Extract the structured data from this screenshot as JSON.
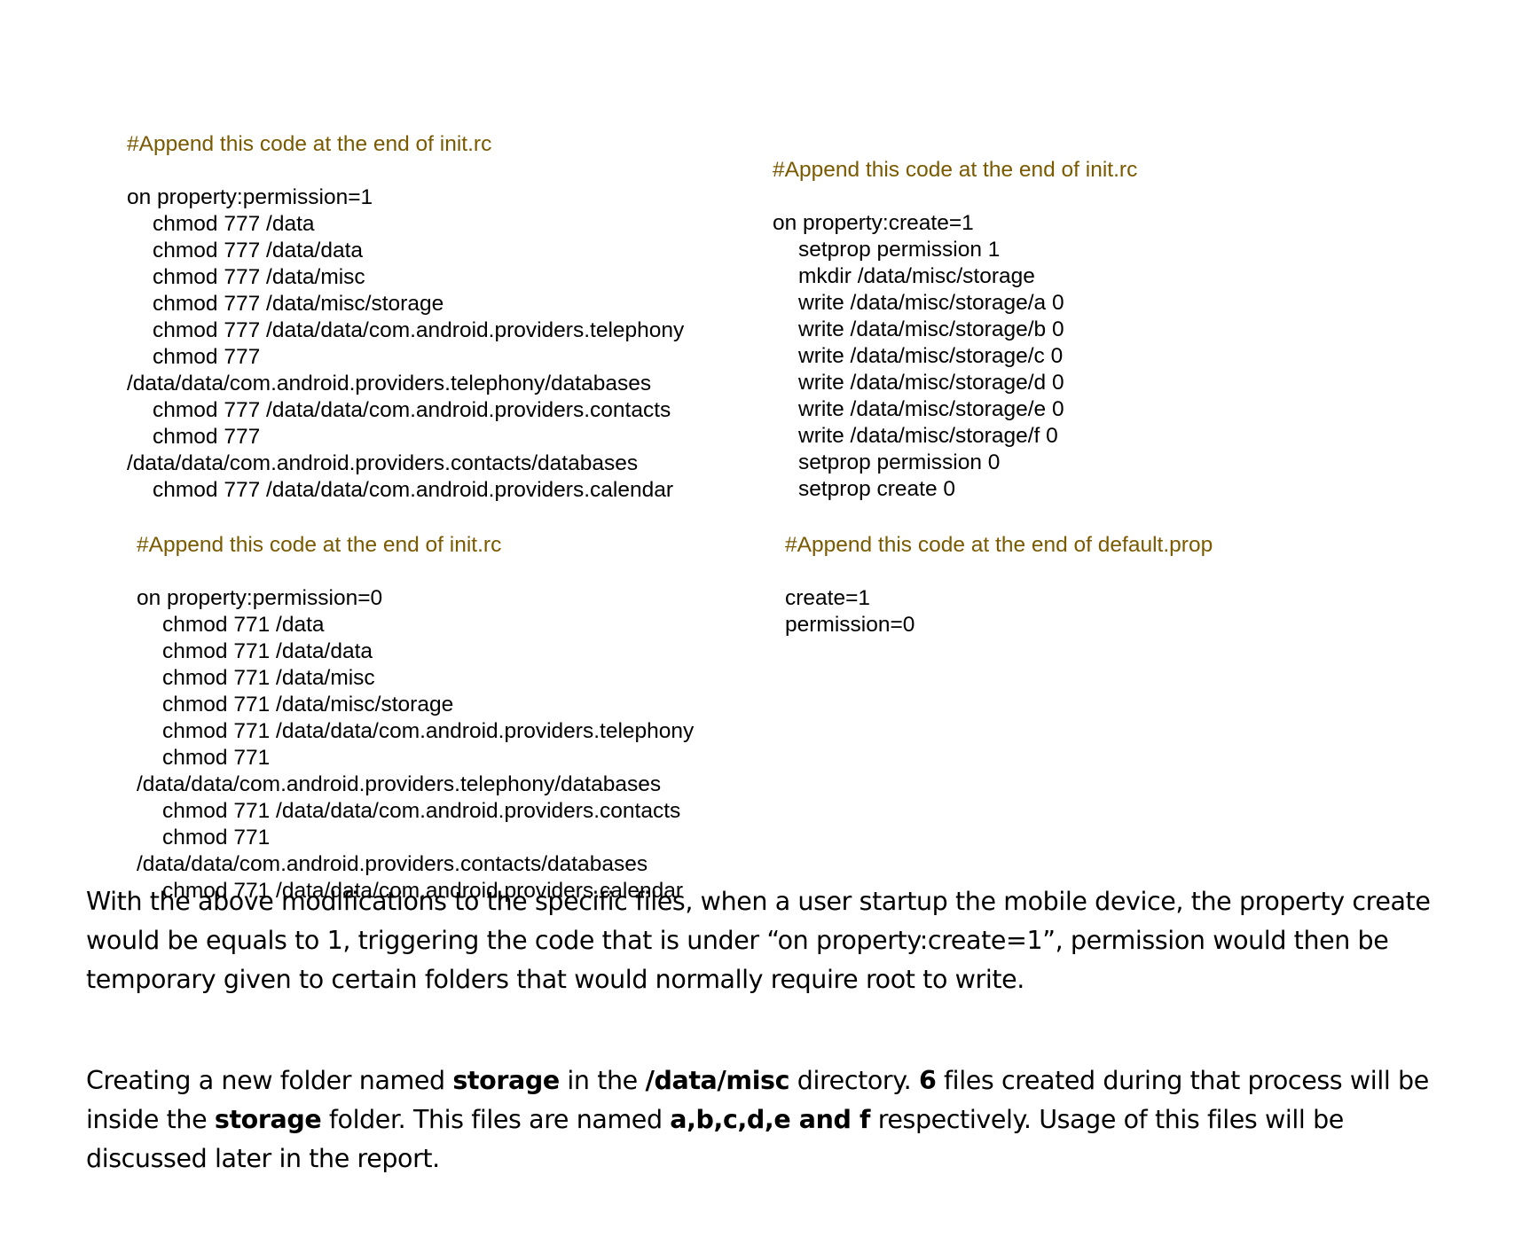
{
  "blocks": {
    "top_left": {
      "comment": "#Append this code at the end of init.rc",
      "lines": [
        {
          "text": "on property:permission=1",
          "indent": false
        },
        {
          "text": "chmod 777 /data",
          "indent": true
        },
        {
          "text": "chmod 777 /data/data",
          "indent": true
        },
        {
          "text": "chmod 777 /data/misc",
          "indent": true
        },
        {
          "text": "chmod 777 /data/misc/storage",
          "indent": true
        },
        {
          "text": "chmod 777 /data/data/com.android.providers.telephony",
          "indent": true
        },
        {
          "text": "chmod 777",
          "indent": true
        },
        {
          "text": "/data/data/com.android.providers.telephony/databases",
          "indent": false
        },
        {
          "text": "chmod 777 /data/data/com.android.providers.contacts",
          "indent": true
        },
        {
          "text": "chmod 777",
          "indent": true
        },
        {
          "text": "/data/data/com.android.providers.contacts/databases",
          "indent": false
        },
        {
          "text": "chmod 777 /data/data/com.android.providers.calendar",
          "indent": true
        }
      ]
    },
    "top_right": {
      "comment": "#Append this code at the end of init.rc",
      "lines": [
        {
          "text": "on property:create=1",
          "indent": false
        },
        {
          "text": "setprop permission 1",
          "indent": true
        },
        {
          "text": "mkdir /data/misc/storage",
          "indent": true
        },
        {
          "text": "write /data/misc/storage/a 0",
          "indent": true
        },
        {
          "text": "write /data/misc/storage/b 0",
          "indent": true
        },
        {
          "text": "write /data/misc/storage/c 0",
          "indent": true
        },
        {
          "text": "write /data/misc/storage/d 0",
          "indent": true
        },
        {
          "text": "write /data/misc/storage/e 0",
          "indent": true
        },
        {
          "text": "write /data/misc/storage/f 0",
          "indent": true
        },
        {
          "text": "setprop permission 0",
          "indent": true
        },
        {
          "text": "setprop create 0",
          "indent": true
        }
      ]
    },
    "bottom_left": {
      "comment": "#Append this code at the end of init.rc",
      "lines": [
        {
          "text": "on property:permission=0",
          "indent": false
        },
        {
          "text": "chmod 771 /data",
          "indent": true
        },
        {
          "text": "chmod 771 /data/data",
          "indent": true
        },
        {
          "text": "chmod 771 /data/misc",
          "indent": true
        },
        {
          "text": "chmod 771 /data/misc/storage",
          "indent": true
        },
        {
          "text": "chmod 771 /data/data/com.android.providers.telephony",
          "indent": true
        },
        {
          "text": "chmod 771",
          "indent": true
        },
        {
          "text": "/data/data/com.android.providers.telephony/databases",
          "indent": false
        },
        {
          "text": "chmod 771 /data/data/com.android.providers.contacts",
          "indent": true
        },
        {
          "text": "chmod 771",
          "indent": true
        },
        {
          "text": "/data/data/com.android.providers.contacts/databases",
          "indent": false
        },
        {
          "text": "chmod 771 /data/data/com.android.providers.calendar",
          "indent": true
        }
      ]
    },
    "bottom_right": {
      "comment": "#Append this code at the end of default.prop",
      "lines": [
        {
          "text": "create=1",
          "indent": false
        },
        {
          "text": "permission=0",
          "indent": false
        }
      ]
    }
  },
  "paragraphs": [
    {
      "segments": [
        {
          "text": "With the above modifications to the specific files, when a user startup the mobile device, the property create would be equals to 1, triggering the code that is under “on property:create=1”, permission would then be temporary given to certain folders that would normally require root to write.",
          "bold": false
        }
      ]
    },
    {
      "segments": [
        {
          "text": "Creating a new folder named ",
          "bold": false
        },
        {
          "text": "storage",
          "bold": true
        },
        {
          "text": " in the ",
          "bold": false
        },
        {
          "text": "/data/misc",
          "bold": true
        },
        {
          "text": " directory. ",
          "bold": false
        },
        {
          "text": "6",
          "bold": true
        },
        {
          "text": " files created during that process will be inside the ",
          "bold": false
        },
        {
          "text": "storage",
          "bold": true
        },
        {
          "text": " folder. This files are named ",
          "bold": false
        },
        {
          "text": "a,b,c,d,e and f",
          "bold": true
        },
        {
          "text": " respectively. Usage of this files will be discussed later in the report.",
          "bold": false
        }
      ]
    }
  ],
  "colors": {
    "comment": "#7a5a00",
    "text": "#000000",
    "background": "#ffffff"
  }
}
